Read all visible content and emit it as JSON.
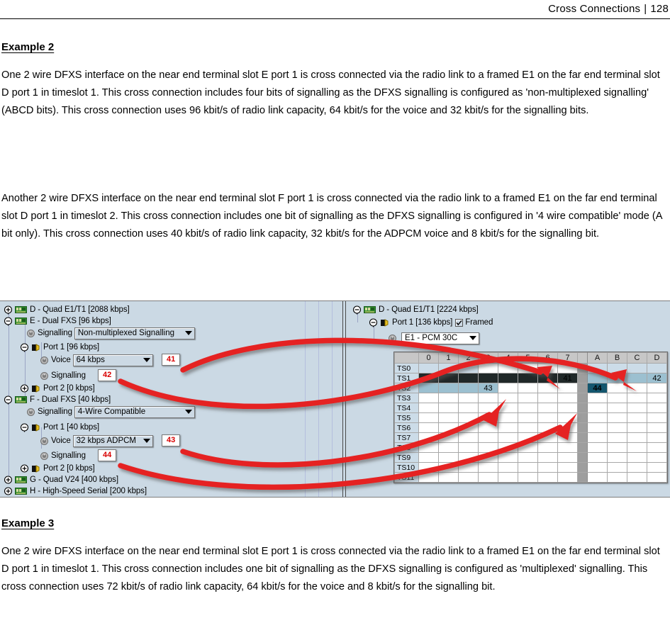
{
  "header": {
    "title": "Cross Connections",
    "separator": "|",
    "page_number": "128"
  },
  "sections": [
    {
      "heading": "Example 2",
      "paragraphs": [
        "One 2 wire DFXS interface on the near end terminal slot E port 1 is cross connected via the radio link to a framed E1 on the far end terminal slot D port 1 in timeslot 1. This cross connection includes four bits of signalling as the DFXS signalling is configured as 'non-multiplexed signalling' (ABCD bits). This cross connection uses 96 kbit/s of radio link capacity, 64 kbit/s for the voice and 32 kbit/s for the signalling bits.",
        "Another 2 wire DFXS interface on the near end terminal slot F port 1 is cross connected via the radio link to a framed E1 on the far end terminal slot D port 1 in timeslot 2. This cross connection includes one bit of signalling as the DFXS signalling is configured in '4 wire compatible' mode (A bit only). This cross connection uses 40 kbit/s of radio link capacity, 32 kbit/s for the ADPCM voice and 8 kbit/s for the signalling bit."
      ]
    },
    {
      "heading": "Example 3",
      "paragraphs": [
        "One 2 wire DFXS interface on the near end terminal slot E port 1 is cross connected via the radio link to a framed E1 on the far end terminal slot D port 1 in timeslot 1. This cross connection includes one bit of signalling as the DFXS signalling is configured as 'multiplexed' signalling. This cross connection uses 72 kbit/s of radio link capacity, 64 kbit/s for the voice and 8 kbit/s for the signalling bit."
      ]
    }
  ],
  "screenshot": {
    "near_end_tree": {
      "nodes": [
        {
          "label": "D - Quad E1/T1 [2088 kbps]",
          "icon": "card-icon",
          "toggle": "expand-plus"
        },
        {
          "label": "E - Dual FXS [96 kbps]",
          "icon": "card-icon",
          "toggle": "collapse-minus"
        },
        {
          "label": "Signalling",
          "icon": "knob-icon",
          "combo": "Non-multiplexed Signalling"
        },
        {
          "label": "Port 1 [96 kbps]",
          "icon": "port-icon",
          "toggle": "collapse-minus"
        },
        {
          "label": "Voice",
          "icon": "knob-icon",
          "combo": "64 kbps",
          "tag": "41"
        },
        {
          "label": "Signalling",
          "icon": "knob-icon",
          "tag": "42"
        },
        {
          "label": "Port 2 [0 kbps]",
          "icon": "port-icon",
          "toggle": "expand-plus"
        },
        {
          "label": "F - Dual FXS [40 kbps]",
          "icon": "card-icon",
          "toggle": "collapse-minus"
        },
        {
          "label": "Signalling",
          "icon": "knob-icon",
          "combo": "4-Wire Compatible"
        },
        {
          "label": "Port 1 [40 kbps]",
          "icon": "port-icon",
          "toggle": "collapse-minus"
        },
        {
          "label": "Voice",
          "icon": "knob-icon",
          "combo": "32 kbps ADPCM",
          "tag": "43"
        },
        {
          "label": "Signalling",
          "icon": "knob-icon",
          "tag": "44"
        },
        {
          "label": "Port 2 [0 kbps]",
          "icon": "port-icon",
          "toggle": "expand-plus"
        },
        {
          "label": "G - Quad V24 [400 kbps]",
          "icon": "card-icon",
          "toggle": "expand-plus"
        },
        {
          "label": "H - High-Speed Serial [200 kbps]",
          "icon": "card-icon",
          "toggle": "expand-plus"
        }
      ]
    },
    "far_end_tree": {
      "nodes": [
        {
          "label": "D - Quad E1/T1 [2224 kbps]",
          "icon": "card-icon",
          "toggle": "collapse-minus"
        },
        {
          "label": "Port 1 [136 kbps]",
          "icon": "port-icon",
          "toggle": "collapse-minus",
          "checkbox_label": "Framed",
          "checkbox_checked": true
        },
        {
          "label": "",
          "icon": "knob-icon",
          "combo": "E1 - PCM 30C"
        }
      ]
    },
    "timeslot_grid": {
      "column_headers": [
        "0",
        "1",
        "2",
        "3",
        "4",
        "5",
        "6",
        "7",
        "A",
        "B",
        "C",
        "D"
      ],
      "row_headers": [
        "TS0",
        "TS1",
        "TS2",
        "TS3",
        "TS4",
        "TS5",
        "TS6",
        "TS7",
        "TS8",
        "TS9",
        "TS10",
        "TS11"
      ],
      "cells": [
        {
          "row": "TS0",
          "col": "0",
          "state": "light",
          "text": ""
        },
        {
          "row": "TS0",
          "col": "1",
          "state": "light",
          "text": ""
        },
        {
          "row": "TS0",
          "col": "2",
          "state": "light",
          "text": ""
        },
        {
          "row": "TS0",
          "col": "A",
          "state": "light",
          "text": ""
        },
        {
          "row": "TS0",
          "col": "B",
          "state": "light",
          "text": ""
        },
        {
          "row": "TS0",
          "col": "C",
          "state": "light",
          "text": ""
        },
        {
          "row": "TS0",
          "col": "D",
          "state": "light",
          "text": ""
        },
        {
          "row": "TS1",
          "col": "0",
          "state": "dark",
          "text": ""
        },
        {
          "row": "TS1",
          "col": "1",
          "state": "dark",
          "text": ""
        },
        {
          "row": "TS1",
          "col": "2",
          "state": "dark",
          "text": ""
        },
        {
          "row": "TS1",
          "col": "3",
          "state": "dark",
          "text": ""
        },
        {
          "row": "TS1",
          "col": "4",
          "state": "dark",
          "text": ""
        },
        {
          "row": "TS1",
          "col": "5",
          "state": "dark",
          "text": ""
        },
        {
          "row": "TS1",
          "col": "6",
          "state": "dark",
          "text": ""
        },
        {
          "row": "TS1",
          "col": "7",
          "state": "dark",
          "text": "41"
        },
        {
          "row": "TS1",
          "col": "A",
          "state": "mid",
          "text": ""
        },
        {
          "row": "TS1",
          "col": "B",
          "state": "mid",
          "text": ""
        },
        {
          "row": "TS1",
          "col": "C",
          "state": "mid",
          "text": ""
        },
        {
          "row": "TS1",
          "col": "D",
          "state": "mid",
          "text": "42"
        },
        {
          "row": "TS2",
          "col": "0",
          "state": "mid",
          "text": ""
        },
        {
          "row": "TS2",
          "col": "1",
          "state": "mid",
          "text": ""
        },
        {
          "row": "TS2",
          "col": "2",
          "state": "mid",
          "text": ""
        },
        {
          "row": "TS2",
          "col": "3",
          "state": "mid",
          "text": "43"
        },
        {
          "row": "TS2",
          "col": "A",
          "state": "navy",
          "text": "44"
        }
      ],
      "callout_labels": [
        "41",
        "42",
        "43",
        "44"
      ]
    },
    "colors": {
      "panel_background": "#cbd9e4",
      "cell_light": "#ccdce8",
      "cell_mid": "#9cc0d0",
      "cell_dark": "#202828",
      "cell_navy": "#14566e",
      "arrow_red": "#e52020",
      "tag_text": "#d80000",
      "grid_header": "#c7c7c7",
      "gap_column": "#9e9e9e"
    }
  }
}
